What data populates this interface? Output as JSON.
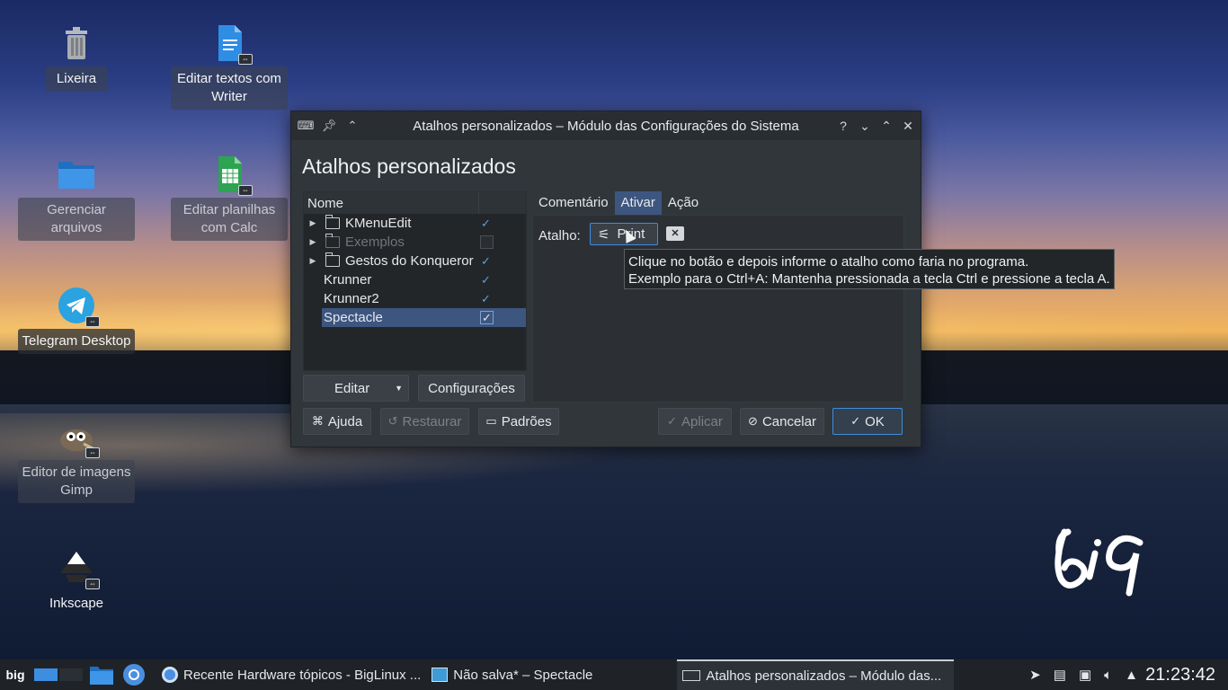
{
  "desktop": {
    "icons": [
      {
        "label": "Lixeira",
        "icon": "trash-icon"
      },
      {
        "label": "Editar textos com Writer",
        "icon": "writer-doc-icon"
      },
      {
        "label": "Gerenciar arquivos",
        "icon": "folder-icon"
      },
      {
        "label": "Editar planilhas com Calc",
        "icon": "calc-sheet-icon"
      },
      {
        "label": "Telegram Desktop",
        "icon": "telegram-icon"
      },
      {
        "label": "Editor de imagens Gimp",
        "icon": "gimp-icon"
      },
      {
        "label": "Inkscape",
        "icon": "inkscape-icon"
      }
    ]
  },
  "window": {
    "title": "Atalhos personalizados – Módulo das Configurações do Sistema",
    "page_title": "Atalhos personalizados",
    "tree": {
      "header": "Nome",
      "items": [
        {
          "label": "KMenuEdit",
          "folder": true,
          "checked": true
        },
        {
          "label": "Exemplos",
          "folder": true,
          "checked": false
        },
        {
          "label": "Gestos do Konqueror",
          "folder": true,
          "checked": true
        },
        {
          "label": "Krunner",
          "folder": false,
          "checked": true
        },
        {
          "label": "Krunner2",
          "folder": false,
          "checked": true
        },
        {
          "label": "Spectacle",
          "folder": false,
          "checked": true,
          "selected": true
        }
      ]
    },
    "edit_button": "Editar",
    "config_button": "Configurações",
    "tabs": [
      "Comentário",
      "Ativar",
      "Ação"
    ],
    "active_tab": "Ativar",
    "shortcut_label": "Atalho:",
    "shortcut_value": "Print",
    "tooltip_line1": "Clique no botão e depois informe o atalho como faria no programa.",
    "tooltip_line2": "Exemplo para o Ctrl+A: Mantenha pressionada a tecla Ctrl e pressione a tecla A.",
    "footer": {
      "help": "Ajuda",
      "restore": "Restaurar",
      "defaults": "Padrões",
      "apply": "Aplicar",
      "cancel": "Cancelar",
      "ok": "OK"
    }
  },
  "taskbar": {
    "logo": "big",
    "tasks": [
      {
        "label": "Recente Hardware tópicos - BigLinux ...",
        "icon": "chromium-icon"
      },
      {
        "label": "Não salva* – Spectacle",
        "icon": "spectacle-icon"
      },
      {
        "label": "Atalhos personalizados – Módulo das...",
        "icon": "keyboard-icon",
        "active": true
      }
    ],
    "clock": "21:23:42"
  },
  "colors": {
    "accent": "#3d8ee0",
    "selection": "#3d5680",
    "window_bg": "#31363b"
  }
}
